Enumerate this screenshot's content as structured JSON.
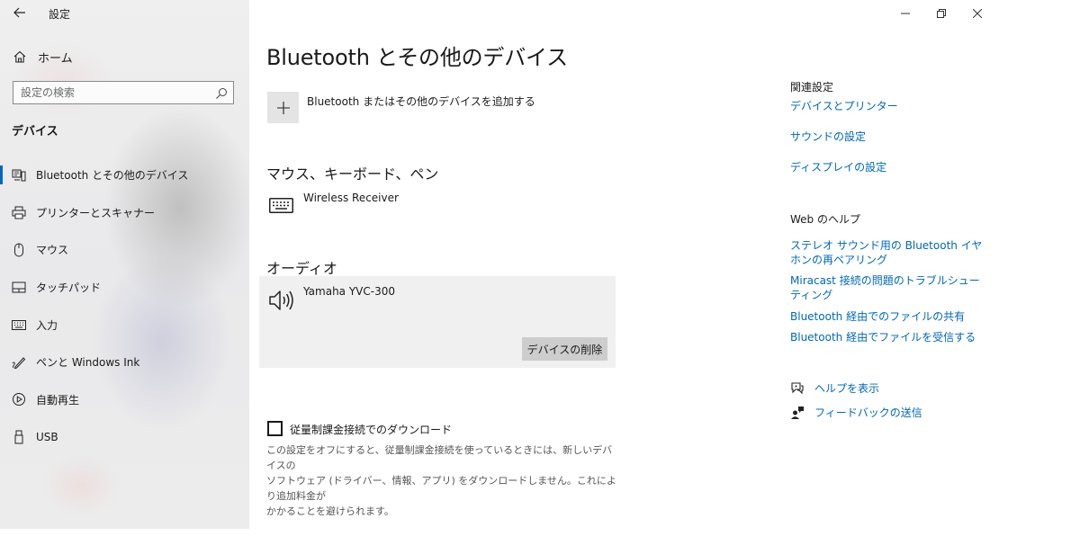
{
  "window": {
    "title": "設定",
    "controls": [
      "minimize",
      "restore",
      "close"
    ]
  },
  "sidebar": {
    "home_label": "ホーム",
    "search_placeholder": "設定の検索",
    "section_title": "デバイス",
    "items": [
      {
        "label": "Bluetooth とその他のデバイス",
        "icon": "bluetooth-devices-icon",
        "selected": true
      },
      {
        "label": "プリンターとスキャナー",
        "icon": "printer-icon",
        "selected": false
      },
      {
        "label": "マウス",
        "icon": "mouse-icon",
        "selected": false
      },
      {
        "label": "タッチパッド",
        "icon": "touchpad-icon",
        "selected": false
      },
      {
        "label": "入力",
        "icon": "keyboard-icon",
        "selected": false
      },
      {
        "label": "ペンと Windows Ink",
        "icon": "pen-icon",
        "selected": false
      },
      {
        "label": "自動再生",
        "icon": "autoplay-icon",
        "selected": false
      },
      {
        "label": "USB",
        "icon": "usb-icon",
        "selected": false
      }
    ]
  },
  "main": {
    "title": "Bluetooth とその他のデバイス",
    "add_device_label": "Bluetooth またはその他のデバイスを追加する",
    "mouse_section": {
      "title": "マウス、キーボード、ペン",
      "devices": [
        {
          "name": "Wireless Receiver",
          "icon": "keyboard-icon"
        }
      ]
    },
    "audio_section": {
      "title": "オーディオ",
      "devices": [
        {
          "name": "Yamaha YVC-300",
          "icon": "speaker-icon",
          "selected": true
        }
      ],
      "remove_button": "デバイスの削除"
    },
    "metered": {
      "checkbox_label": "従量制課金接続でのダウンロード",
      "checked": false,
      "description_lines": [
        "この設定をオフにすると、従量制課金接続を使っているときには、新しいデバイスの",
        "ソフトウェア (ドライバー、情報、アプリ) をダウンロードしません。これにより追加料金が",
        "かかることを避けられます。"
      ]
    }
  },
  "related": {
    "title": "関連設定",
    "links": [
      "デバイスとプリンター",
      "サウンドの設定",
      "ディスプレイの設定"
    ]
  },
  "web_help": {
    "title": "Web のヘルプ",
    "links": [
      "ステレオ サウンド用の Bluetooth イヤホンの再ペアリング",
      "Miracast 接続の問題のトラブルシューティング",
      "Bluetooth 経由でのファイルの共有",
      "Bluetooth 経由でファイルを受信する"
    ]
  },
  "help_actions": {
    "get_help": "ヘルプを表示",
    "feedback": "フィードバックの送信"
  },
  "colors": {
    "accent": "#0067c0",
    "link": "#0067b8",
    "sidebar_bg": "#ececec",
    "card_bg": "#f0f0f0",
    "button_bg": "#cdcdcd"
  }
}
